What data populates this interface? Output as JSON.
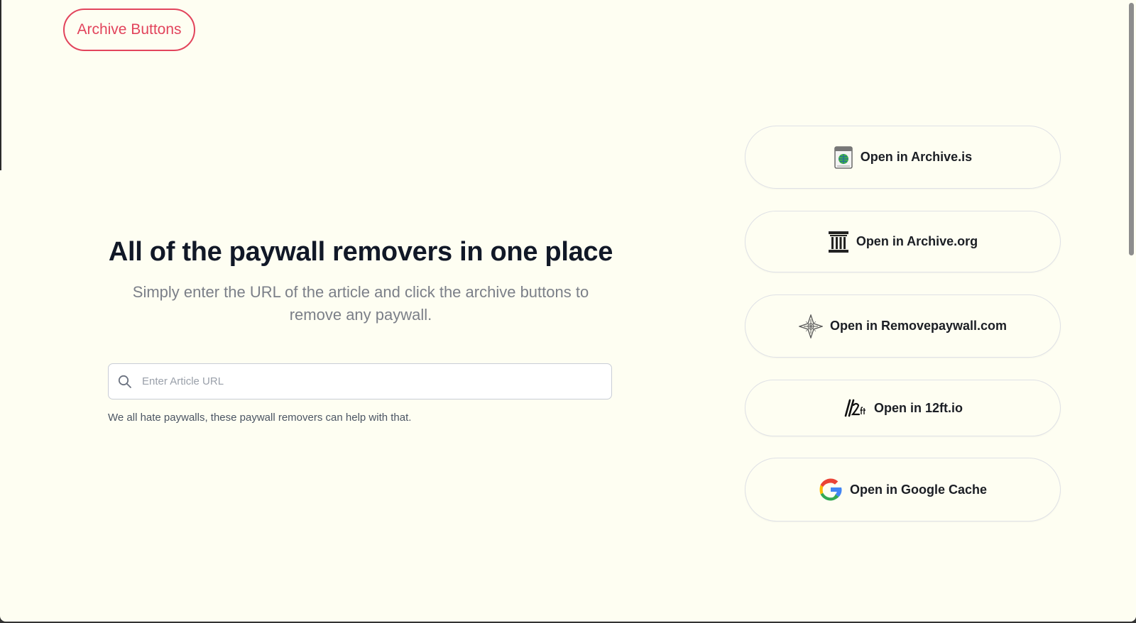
{
  "header": {
    "logo_label": "Archive Buttons"
  },
  "hero": {
    "title": "All of the paywall removers in one place",
    "subtitle": "Simply enter the URL of the article and click the archive buttons to remove any paywall."
  },
  "search": {
    "placeholder": "Enter Article URL",
    "value": "",
    "icon": "search-icon"
  },
  "helper_text": "We all hate paywalls, these paywall removers can help with that.",
  "archive_buttons": [
    {
      "label": "Open in Archive.is",
      "icon": "archive-is-icon"
    },
    {
      "label": "Open in Archive.org",
      "icon": "archive-org-icon"
    },
    {
      "label": "Open in Removepaywall.com",
      "icon": "removepaywall-icon"
    },
    {
      "label": "Open in 12ft.io",
      "icon": "twelve-ft-icon"
    },
    {
      "label": "Open in Google Cache",
      "icon": "google-icon"
    }
  ],
  "colors": {
    "background": "#fefef2",
    "accent": "#e2445c",
    "text": "#111827",
    "muted": "#7b7f88"
  }
}
